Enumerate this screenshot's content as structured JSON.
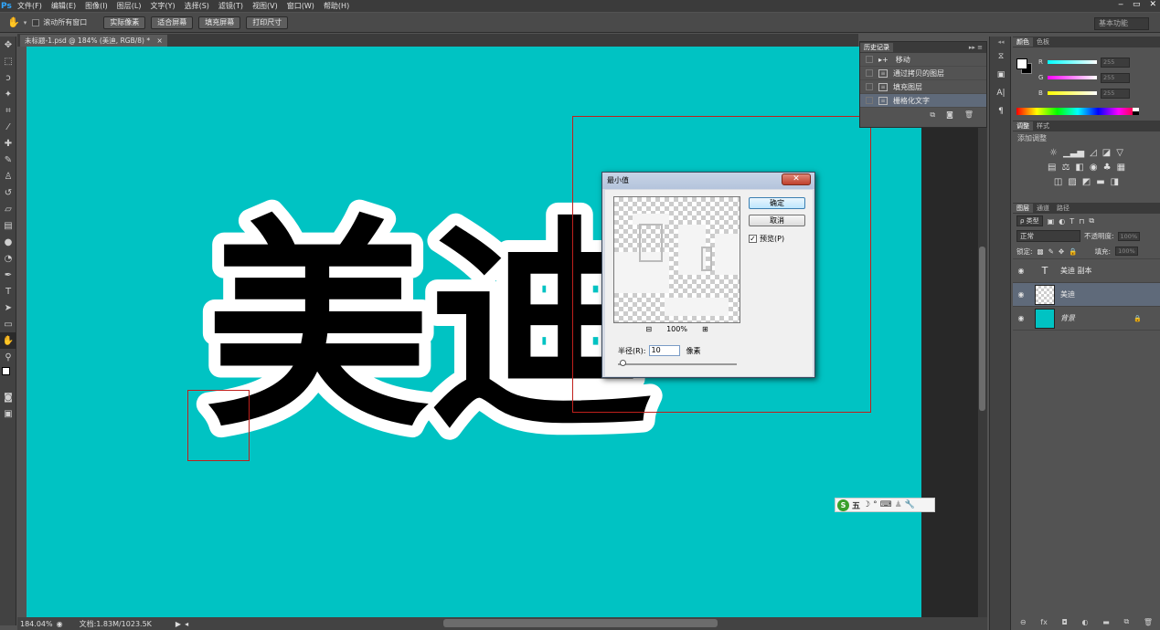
{
  "menubar": {
    "app_icon": "Ps",
    "items": [
      "文件(F)",
      "编辑(E)",
      "图像(I)",
      "图层(L)",
      "文字(Y)",
      "选择(S)",
      "滤镜(T)",
      "视图(V)",
      "窗口(W)",
      "帮助(H)"
    ],
    "window_controls": [
      "‒",
      "▭",
      "✕"
    ]
  },
  "options_bar": {
    "scroll_all_windows": "滚动所有窗口",
    "btn_actual_pixels": "实际像素",
    "btn_fit_screen": "适合屏幕",
    "btn_fill_screen": "填充屏幕",
    "btn_print_size": "打印尺寸",
    "workspace": "基本功能"
  },
  "document": {
    "tab_title": "未标题-1.psd @ 184% (美迪, RGB/8) *",
    "canvas_text": "美迪",
    "canvas_color": "#00c3c3",
    "zoom_status": "184.04%",
    "doc_status": "文档:1.83M/1023.5K"
  },
  "history_panel": {
    "tab": "历史记录",
    "items": [
      {
        "label": "移动",
        "icon": "move-icon"
      },
      {
        "label": "通过拷贝的图层",
        "icon": "layer-icon"
      },
      {
        "label": "填充图层",
        "icon": "layer-icon"
      },
      {
        "label": "栅格化文字",
        "icon": "layer-icon"
      }
    ]
  },
  "color_panel": {
    "tabs": [
      "颜色",
      "色板"
    ],
    "channels": [
      {
        "label": "R",
        "value": "255"
      },
      {
        "label": "G",
        "value": "255"
      },
      {
        "label": "B",
        "value": "255"
      }
    ]
  },
  "adjustments_panel": {
    "tabs": [
      "调整",
      "样式"
    ],
    "subtitle": "添加调整"
  },
  "layers_panel": {
    "tabs": [
      "图层",
      "通道",
      "路径"
    ],
    "filter_kind": "ρ 类型",
    "blend_mode": "正常",
    "opacity_label": "不透明度:",
    "opacity_value": "100%",
    "lock_label": "锁定:",
    "fill_label": "填充:",
    "fill_value": "100%",
    "layers": [
      {
        "name": "美迪 副本",
        "type": "text"
      },
      {
        "name": "美迪",
        "type": "pixel",
        "selected": true
      },
      {
        "name": "背景",
        "type": "background"
      }
    ]
  },
  "dialog": {
    "title": "最小值",
    "close": "✕",
    "ok": "确定",
    "cancel": "取消",
    "preview_label": "预览(P)",
    "preview_checked": true,
    "zoom_minus": "⊟",
    "zoom_value": "100%",
    "zoom_plus": "⊞",
    "radius_label": "半径(R):",
    "radius_value": "10",
    "radius_unit": "像素"
  },
  "ime_bar": {
    "logo": "S",
    "mode": "五",
    "icons": [
      "☽",
      "°",
      "⌨",
      "♟",
      "🔧"
    ]
  }
}
